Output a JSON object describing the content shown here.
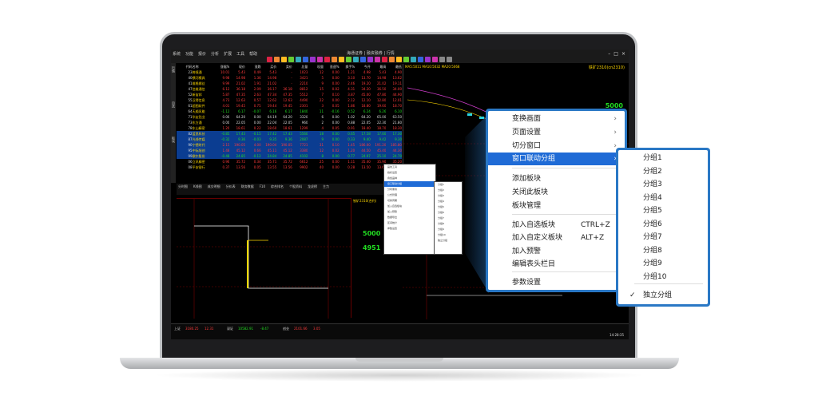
{
  "app": {
    "menu": [
      "系统",
      "功能",
      "报价",
      "分析",
      "扩展",
      "工具",
      "帮助"
    ],
    "title": "海通证券 | 融资融券 | 行情"
  },
  "screen": {
    "left_tab_labels": [
      "行情",
      "自选",
      "板块"
    ],
    "quote_header": [
      "代码",
      "名称",
      "涨幅%",
      "现价",
      "涨跌",
      "买价",
      "卖价",
      "总量",
      "现量",
      "涨速%",
      "换手%",
      "今开",
      "最高",
      "最低"
    ],
    "quote_rows": [
      {
        "code": "23",
        "name": "跨境通",
        "cls": "red",
        "vals": [
          "10.01",
          "5.43",
          "0.49",
          "5.43",
          "-",
          "1023",
          "12",
          "0.00",
          "1.21",
          "4.98",
          "5.43",
          "4.90"
        ]
      },
      {
        "code": "40",
        "name": "横河模具",
        "cls": "red",
        "vals": [
          "9.98",
          "14.98",
          "1.36",
          "14.98",
          "-",
          "3421",
          "5",
          "0.00",
          "3.10",
          "13.70",
          "14.98",
          "13.62"
        ]
      },
      {
        "code": "41",
        "name": "维格娜丝",
        "cls": "red",
        "vals": [
          "9.99",
          "21.02",
          "1.91",
          "21.02",
          "-",
          "2210",
          "9",
          "0.00",
          "2.46",
          "19.20",
          "21.02",
          "19.11"
        ]
      },
      {
        "code": "47",
        "name": "信维通信",
        "cls": "red",
        "vals": [
          "6.12",
          "36.18",
          "2.09",
          "36.17",
          "36.18",
          "8812",
          "15",
          "0.02",
          "4.31",
          "34.20",
          "36.50",
          "34.00"
        ]
      },
      {
        "code": "52",
        "name": "新宙邦",
        "cls": "red",
        "vals": [
          "5.87",
          "47.35",
          "2.63",
          "47.34",
          "47.35",
          "5512",
          "7",
          "0.10",
          "3.87",
          "45.00",
          "47.80",
          "44.90"
        ]
      },
      {
        "code": "55",
        "name": "汉得信息",
        "cls": "red",
        "vals": [
          "4.73",
          "12.63",
          "0.57",
          "12.62",
          "12.63",
          "4490",
          "22",
          "0.00",
          "2.12",
          "12.10",
          "12.80",
          "12.01"
        ]
      },
      {
        "code": "61",
        "name": "超图软件",
        "cls": "red",
        "vals": [
          "4.01",
          "19.45",
          "0.75",
          "19.44",
          "19.45",
          "2301",
          "3",
          "0.05",
          "1.86",
          "18.80",
          "19.60",
          "18.70"
        ]
      },
      {
        "code": "64",
        "name": "天顺风能",
        "cls": "grn",
        "vals": [
          "-1.12",
          "6.17",
          "-0.07",
          "6.16",
          "6.17",
          "1840",
          "11",
          "-0.16",
          "0.52",
          "6.24",
          "6.26",
          "6.10"
        ]
      },
      {
        "code": "71",
        "name": "华友钴业",
        "cls": "wht",
        "vals": [
          "0.00",
          "64.20",
          "0.00",
          "64.19",
          "64.20",
          "3320",
          "6",
          "0.00",
          "1.02",
          "64.20",
          "65.00",
          "63.50"
        ]
      },
      {
        "code": "73",
        "name": "东方通",
        "cls": "wht",
        "vals": [
          "0.00",
          "22.05",
          "0.00",
          "22.04",
          "22.05",
          "960",
          "2",
          "0.00",
          "0.88",
          "22.05",
          "22.30",
          "21.80"
        ]
      },
      {
        "code": "78",
        "name": "东山精密",
        "cls": "red",
        "vals": [
          "1.20",
          "18.61",
          "0.22",
          "18.60",
          "18.61",
          "1299",
          "4",
          "0.05",
          "0.91",
          "18.40",
          "18.70",
          "18.30"
        ]
      },
      {
        "code": "82",
        "name": "蓝思科技",
        "cls": "grn",
        "vals": [
          "-0.85",
          "17.43",
          "-0.15",
          "17.42",
          "17.43",
          "5560",
          "18",
          "0.00",
          "0.65",
          "17.58",
          "17.60",
          "17.30"
        ]
      },
      {
        "code": "87",
        "name": "光线传媒",
        "cls": "grn",
        "vals": [
          "-0.32",
          "9.36",
          "-0.03",
          "9.35",
          "9.36",
          "2087",
          "9",
          "0.00",
          "0.33",
          "9.40",
          "9.42",
          "9.30"
        ]
      },
      {
        "code": "90",
        "name": "宁德时代",
        "cls": "red",
        "vals": [
          "2.15",
          "190.05",
          "4.00",
          "190.04",
          "190.05",
          "7721",
          "31",
          "0.10",
          "1.45",
          "186.00",
          "191.20",
          "185.80"
        ]
      },
      {
        "code": "95",
        "name": "中际旭创",
        "cls": "red",
        "vals": [
          "1.48",
          "45.12",
          "0.66",
          "45.11",
          "45.12",
          "3380",
          "12",
          "0.02",
          "1.20",
          "44.50",
          "45.40",
          "44.30"
        ]
      },
      {
        "code": "99",
        "name": "歌尔股份",
        "cls": "grn",
        "vals": [
          "-0.48",
          "24.85",
          "-0.12",
          "24.84",
          "24.85",
          "4102",
          "8",
          "0.00",
          "0.77",
          "24.97",
          "25.10",
          "24.70"
        ]
      },
      {
        "code": "06",
        "name": "立讯精密",
        "cls": "red",
        "vals": [
          "0.96",
          "35.72",
          "0.34",
          "35.71",
          "35.72",
          "6612",
          "25",
          "0.00",
          "1.11",
          "35.40",
          "35.90",
          "35.20"
        ]
      },
      {
        "code": "08",
        "name": "平安银行",
        "cls": "red",
        "vals": [
          "0.37",
          "13.56",
          "0.05",
          "13.55",
          "13.56",
          "9902",
          "40",
          "0.00",
          "0.28",
          "13.50",
          "13.60",
          "13.44"
        ]
      }
    ],
    "mid_tabs": [
      "分时图",
      "K线图",
      "成交明细",
      "分价表",
      "财务数据",
      "F10",
      "综合排名",
      "个股资料",
      "龙虎榜",
      "主力"
    ],
    "orderbook": {
      "title": "铁矿2310(合约)",
      "price_main": "5000",
      "price_main_change": "1",
      "price_sub": "4951",
      "price_sub_change": "2"
    },
    "chart_tr_title": "铁矿2310(cn2310)",
    "chart_tr_price": "5000",
    "chart_tr_legend": "MA5:5011 MA10:5032 MA20:5068",
    "small_menu_1": [
      "画线工具",
      "指标设置",
      "叠加品种",
      "窗口联动分组",
      "分时重叠",
      "公式管理",
      "切换周期",
      "加入自选板块",
      "加入预警",
      "数据导出",
      "区间统计",
      "参数设置"
    ],
    "small_menu_2": [
      "分组1",
      "分组2",
      "分组3",
      "分组4",
      "分组5",
      "分组6",
      "分组7",
      "分组8",
      "分组9",
      "分组10",
      "独立分组"
    ],
    "status": {
      "index1_name": "上证",
      "index1_val": "3180.25",
      "index1_chg": "12.31",
      "index2_name": "深证",
      "index2_val": "10582.91",
      "index2_chg": "-8.47",
      "index3_name": "创业",
      "index3_val": "2101.66",
      "index3_chg": "3.05",
      "time": "14:28:35"
    }
  },
  "context_menu": {
    "items": [
      {
        "label": "变换画面",
        "shortcut": "",
        "arrow": "›",
        "highlighted": false
      },
      {
        "label": "页面设置",
        "shortcut": "",
        "arrow": "›",
        "highlighted": false
      },
      {
        "label": "切分窗口",
        "shortcut": "",
        "arrow": "›",
        "highlighted": false
      },
      {
        "label": "窗口联动分组",
        "shortcut": "",
        "arrow": "›",
        "highlighted": true
      },
      {
        "label": "添加板块",
        "shortcut": "",
        "arrow": "",
        "highlighted": false
      },
      {
        "label": "关闭此板块",
        "shortcut": "",
        "arrow": "",
        "highlighted": false
      },
      {
        "label": "板块管理",
        "shortcut": "",
        "arrow": "",
        "highlighted": false
      },
      {
        "label": "加入自选板块",
        "shortcut": "CTRL+Z",
        "arrow": "",
        "highlighted": false
      },
      {
        "label": "加入自定义板块",
        "shortcut": "ALT+Z",
        "arrow": "",
        "highlighted": false
      },
      {
        "label": "加入预警",
        "shortcut": "",
        "arrow": "",
        "highlighted": false
      },
      {
        "label": "编辑表头栏目",
        "shortcut": "",
        "arrow": "",
        "highlighted": false
      },
      {
        "label": "参数设置",
        "shortcut": "",
        "arrow": "",
        "highlighted": false
      }
    ]
  },
  "submenu": {
    "items": [
      {
        "label": "分组1",
        "checked": false
      },
      {
        "label": "分组2",
        "checked": false
      },
      {
        "label": "分组3",
        "checked": false
      },
      {
        "label": "分组4",
        "checked": false
      },
      {
        "label": "分组5",
        "checked": false
      },
      {
        "label": "分组6",
        "checked": false
      },
      {
        "label": "分组7",
        "checked": false
      },
      {
        "label": "分组8",
        "checked": false
      },
      {
        "label": "分组9",
        "checked": false
      },
      {
        "label": "分组10",
        "checked": false
      },
      {
        "label": "独立分组",
        "checked": true
      }
    ],
    "check_glyph": "✓"
  },
  "colors": {
    "highlight": "#1f6bd6",
    "menu_border": "#2a78c5",
    "up": "#ff3b3b",
    "down": "#22dd22"
  }
}
